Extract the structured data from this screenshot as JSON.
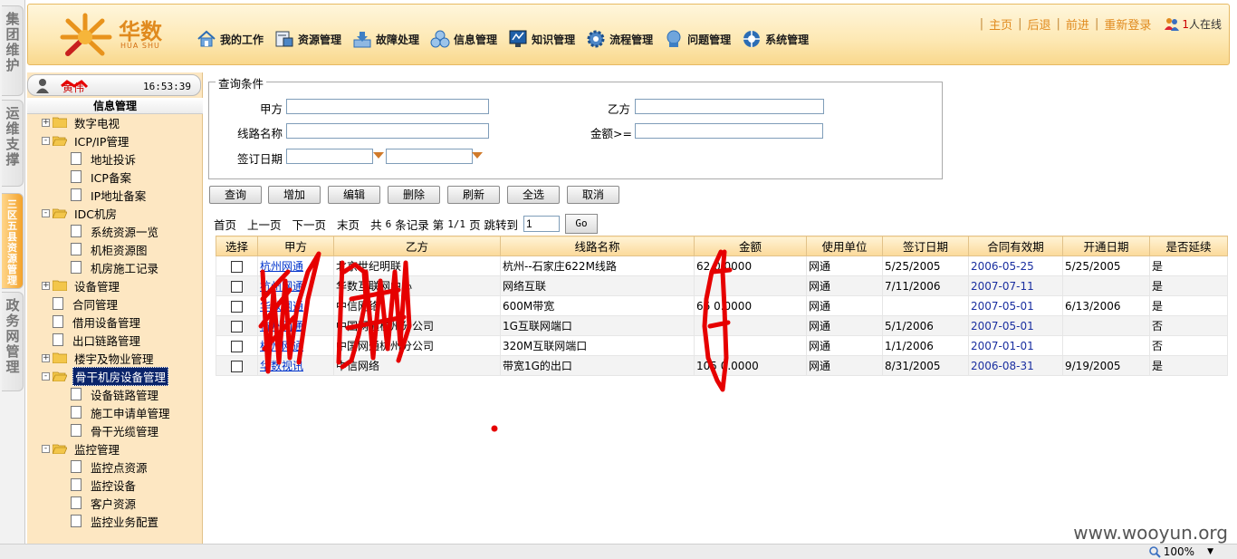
{
  "vtabs": [
    {
      "label": "集团维护",
      "active": false
    },
    {
      "label": "运维支撑",
      "active": false
    },
    {
      "label": "三区五县资源管理",
      "active": true
    },
    {
      "label": "政务网管理",
      "active": false
    }
  ],
  "header": {
    "logo_cn": "华数",
    "logo_en": "HUA SHU",
    "nav": [
      {
        "label": "我的工作",
        "icon": "home-icon"
      },
      {
        "label": "资源管理",
        "icon": "resource-icon"
      },
      {
        "label": "故障处理",
        "icon": "fault-icon"
      },
      {
        "label": "信息管理",
        "icon": "info-icon"
      },
      {
        "label": "知识管理",
        "icon": "knowledge-icon"
      },
      {
        "label": "流程管理",
        "icon": "process-icon"
      },
      {
        "label": "问题管理",
        "icon": "problem-icon"
      },
      {
        "label": "系统管理",
        "icon": "system-icon"
      }
    ],
    "links": {
      "home": "主页",
      "back": "后退",
      "forward": "前进",
      "relogin": "重新登录"
    },
    "online_count": "1",
    "online_suffix": "人在线"
  },
  "sidebar": {
    "user_name": "黄伟",
    "time": "16:53:39",
    "tree_title": "信息管理",
    "tree": [
      {
        "label": "数字电视",
        "level": 0,
        "type": "folder",
        "expander": "+"
      },
      {
        "label": "ICP/IP管理",
        "level": 0,
        "type": "folder-open",
        "expander": "-"
      },
      {
        "label": "地址投诉",
        "level": 1,
        "type": "doc"
      },
      {
        "label": "ICP备案",
        "level": 1,
        "type": "doc"
      },
      {
        "label": "IP地址备案",
        "level": 1,
        "type": "doc"
      },
      {
        "label": "IDC机房",
        "level": 0,
        "type": "folder-open",
        "expander": "-"
      },
      {
        "label": "系统资源一览",
        "level": 1,
        "type": "doc"
      },
      {
        "label": "机柜资源图",
        "level": 1,
        "type": "doc"
      },
      {
        "label": "机房施工记录",
        "level": 1,
        "type": "doc"
      },
      {
        "label": "设备管理",
        "level": 0,
        "type": "folder",
        "expander": "+"
      },
      {
        "label": "合同管理",
        "level": 0,
        "type": "doc"
      },
      {
        "label": "借用设备管理",
        "level": 0,
        "type": "doc"
      },
      {
        "label": "出口链路管理",
        "level": 0,
        "type": "doc"
      },
      {
        "label": "楼宇及物业管理",
        "level": 0,
        "type": "folder",
        "expander": "+"
      },
      {
        "label": "骨干机房设备管理",
        "level": 0,
        "type": "folder-open",
        "expander": "-",
        "selected": true
      },
      {
        "label": "设备链路管理",
        "level": 1,
        "type": "doc"
      },
      {
        "label": "施工申请单管理",
        "level": 1,
        "type": "doc"
      },
      {
        "label": "骨干光缆管理",
        "level": 1,
        "type": "doc"
      },
      {
        "label": "监控管理",
        "level": 0,
        "type": "folder-open",
        "expander": "-"
      },
      {
        "label": "监控点资源",
        "level": 1,
        "type": "doc"
      },
      {
        "label": "监控设备",
        "level": 1,
        "type": "doc"
      },
      {
        "label": "客户资源",
        "level": 1,
        "type": "doc"
      },
      {
        "label": "监控业务配置",
        "level": 1,
        "type": "doc"
      }
    ]
  },
  "query": {
    "legend": "查询条件",
    "party_a_label": "甲方",
    "party_b_label": "乙方",
    "line_name_label": "线路名称",
    "amount_label": "金额>=",
    "sign_date_label": "签订日期",
    "party_a_value": "",
    "party_b_value": "",
    "line_name_value": "",
    "amount_value": "",
    "date_from": "",
    "date_to": ""
  },
  "buttons": [
    "查询",
    "增加",
    "编辑",
    "删除",
    "刷新",
    "全选",
    "取消"
  ],
  "pager": {
    "first": "首页",
    "prev": "上一页",
    "next": "下一页",
    "last": "末页",
    "summary_prefix": "共",
    "total": "6",
    "summary_mid": "条记录 第",
    "page_info": "1/1",
    "summary_suffix": "页 跳转到",
    "jump_value": "1",
    "go_label": "Go"
  },
  "table": {
    "columns": [
      "选择",
      "甲方",
      "乙方",
      "线路名称",
      "金额",
      "使用单位",
      "签订日期",
      "合同有效期",
      "开通日期",
      "是否延续"
    ],
    "rows": [
      {
        "a": "杭州网通",
        "b": "北京世纪明联",
        "line": "杭州--石家庄622M线路",
        "amount": "62   0.0000",
        "unit": "网通",
        "sign": "5/25/2005",
        "valid": "2006-05-25",
        "open": "5/25/2005",
        "cont": "是"
      },
      {
        "a": "杭州网通",
        "b": "华数互联网中心",
        "line": "网络互联",
        "amount": "",
        "unit": "网通",
        "sign": "7/11/2006",
        "valid": "2007-07-11",
        "open": "",
        "cont": "是"
      },
      {
        "a": "华数网通",
        "b": "中信网络",
        "line": "600M带宽",
        "amount": "66   0.0000",
        "unit": "网通",
        "sign": "",
        "valid": "2007-05-01",
        "open": "6/13/2006",
        "cont": "是"
      },
      {
        "a": "杭州网通",
        "b": "中国网通杭州分公司",
        "line": "1G互联网端口",
        "amount": "",
        "unit": "网通",
        "sign": "5/1/2006",
        "valid": "2007-05-01",
        "open": "",
        "cont": "否"
      },
      {
        "a": "杭州网通",
        "b": "中国网通杭州分公司",
        "line": "320M互联网端口",
        "amount": "",
        "unit": "网通",
        "sign": "1/1/2006",
        "valid": "2007-01-01",
        "open": "",
        "cont": "否"
      },
      {
        "a": "华数视讯",
        "b": "中信网络",
        "line": "带宽1G的出口",
        "amount": "105   0.0000",
        "unit": "网通",
        "sign": "8/31/2005",
        "valid": "2006-08-31",
        "open": "9/19/2005",
        "cont": "是"
      }
    ]
  },
  "watermark": "www.wooyun.org",
  "zoom": "100%",
  "colors": {
    "accent": "#e08a1e",
    "selected": "#0a246a",
    "link": "#0033cc",
    "redaction": "#e60000"
  }
}
